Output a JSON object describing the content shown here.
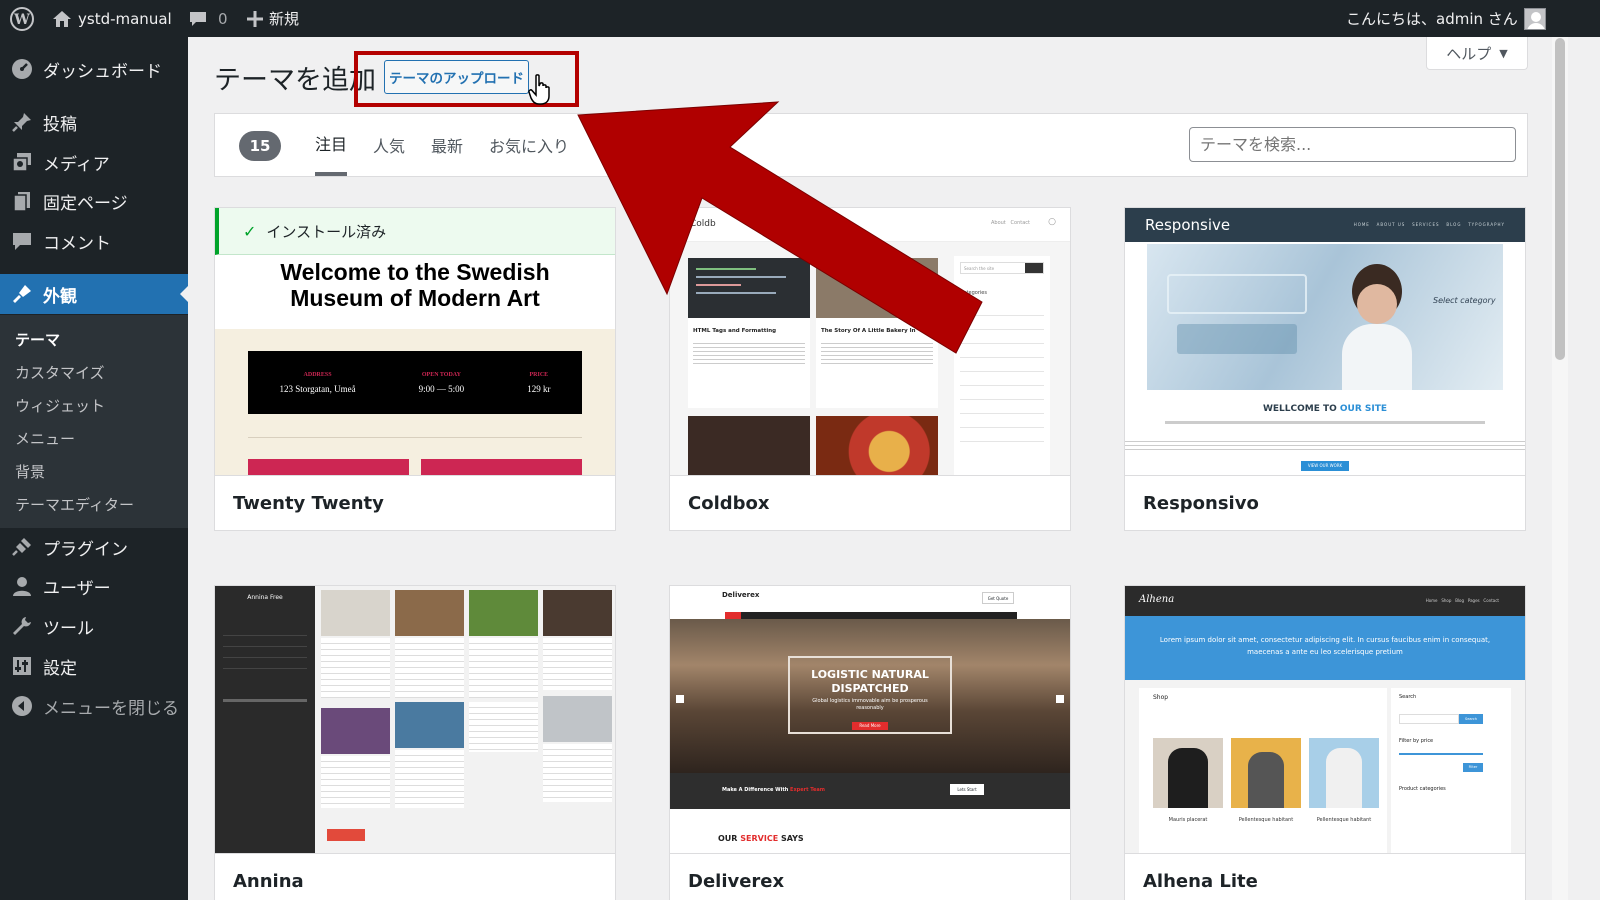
{
  "adminbar": {
    "site_name": "ystd-manual",
    "comments_count": "0",
    "new_label": "新規",
    "greeting": "こんにちは、admin さん"
  },
  "sidebar": {
    "items": [
      {
        "label": "ダッシュボード",
        "icon": "dashboard-icon"
      },
      {
        "label": "投稿",
        "icon": "pin-icon"
      },
      {
        "label": "メディア",
        "icon": "media-icon"
      },
      {
        "label": "固定ページ",
        "icon": "pages-icon"
      },
      {
        "label": "コメント",
        "icon": "comment-icon"
      },
      {
        "label": "外観",
        "icon": "appearance-icon"
      },
      {
        "label": "プラグイン",
        "icon": "plugin-icon"
      },
      {
        "label": "ユーザー",
        "icon": "user-icon"
      },
      {
        "label": "ツール",
        "icon": "wrench-icon"
      },
      {
        "label": "設定",
        "icon": "settings-icon"
      },
      {
        "label": "メニューを閉じる",
        "icon": "collapse-icon"
      }
    ],
    "submenu": [
      "テーマ",
      "カスタマイズ",
      "ウィジェット",
      "メニュー",
      "背景",
      "テーマエディター"
    ]
  },
  "header": {
    "title": "テーマを追加",
    "upload_button": "テーマのアップロード",
    "help_tab": "ヘルプ"
  },
  "filter": {
    "count": "15",
    "tabs": [
      "注目",
      "人気",
      "最新",
      "お気に入り"
    ],
    "search_placeholder": "テーマを検索..."
  },
  "themes": [
    {
      "name": "Twenty Twenty",
      "installed_label": "インストール済み",
      "preview": {
        "heading1": "Welcome to the Swedish",
        "heading2": "Museum of Modern Art",
        "info": [
          {
            "label": "ADDRESS",
            "value": "123 Storgatan, Umeå"
          },
          {
            "label": "OPEN TODAY",
            "value": "9:00 — 5:00"
          },
          {
            "label": "PRICE",
            "value": "129 kr"
          }
        ]
      }
    },
    {
      "name": "Coldbox",
      "preview": {
        "brand": "Coldb",
        "post1": "HTML Tags and Formatting",
        "post2": "The Story Of A Little Bakery In",
        "sidebar_title": "Categories",
        "search": "Search the site"
      }
    },
    {
      "name": "Responsivo",
      "preview": {
        "brand": "Responsive",
        "welcome": "WELLCOME TO",
        "welcome_accent": "OUR SITE",
        "select": "Select category",
        "cta": "VIEW OUR WORK"
      }
    },
    {
      "name": "Annina",
      "preview": {
        "brand": "Annina Free"
      }
    },
    {
      "name": "Deliverex",
      "preview": {
        "brand": "Deliverex",
        "hero1": "LOGISTIC NATURAL",
        "hero2": "DISPATCHED",
        "hero_sub": "Global logistics immovable aim be prosperous reasonably",
        "cta": "Read More",
        "band": "Make A Difference With",
        "band_accent": "Expert Team",
        "band_btn": "Lets Start",
        "footer": "OUR",
        "footer_accent": "SERVICE",
        "footer_end": "SAYS",
        "quote_btn": "Get Quote"
      }
    },
    {
      "name": "Alhena Lite",
      "preview": {
        "brand": "Alhena",
        "banner": "Lorem ipsum dolor sit amet, consectetur adipiscing elit. In cursus faucibus enim in consequat, maecenas a ante eu leo scelerisque pretium",
        "shop": "Shop",
        "search": "Search",
        "filter": "Filter by price",
        "categories": "Product categories",
        "search_btn": "Search",
        "filter_btn": "Filter",
        "p1": "Mauris placerat",
        "p2": "Pellentesque habitant",
        "p3": "Pellentesque habitant"
      }
    }
  ],
  "colors": {
    "accent": "#2271b1",
    "adminbar": "#1d2327",
    "highlight": "#b30000",
    "installed": "#00a32a"
  }
}
